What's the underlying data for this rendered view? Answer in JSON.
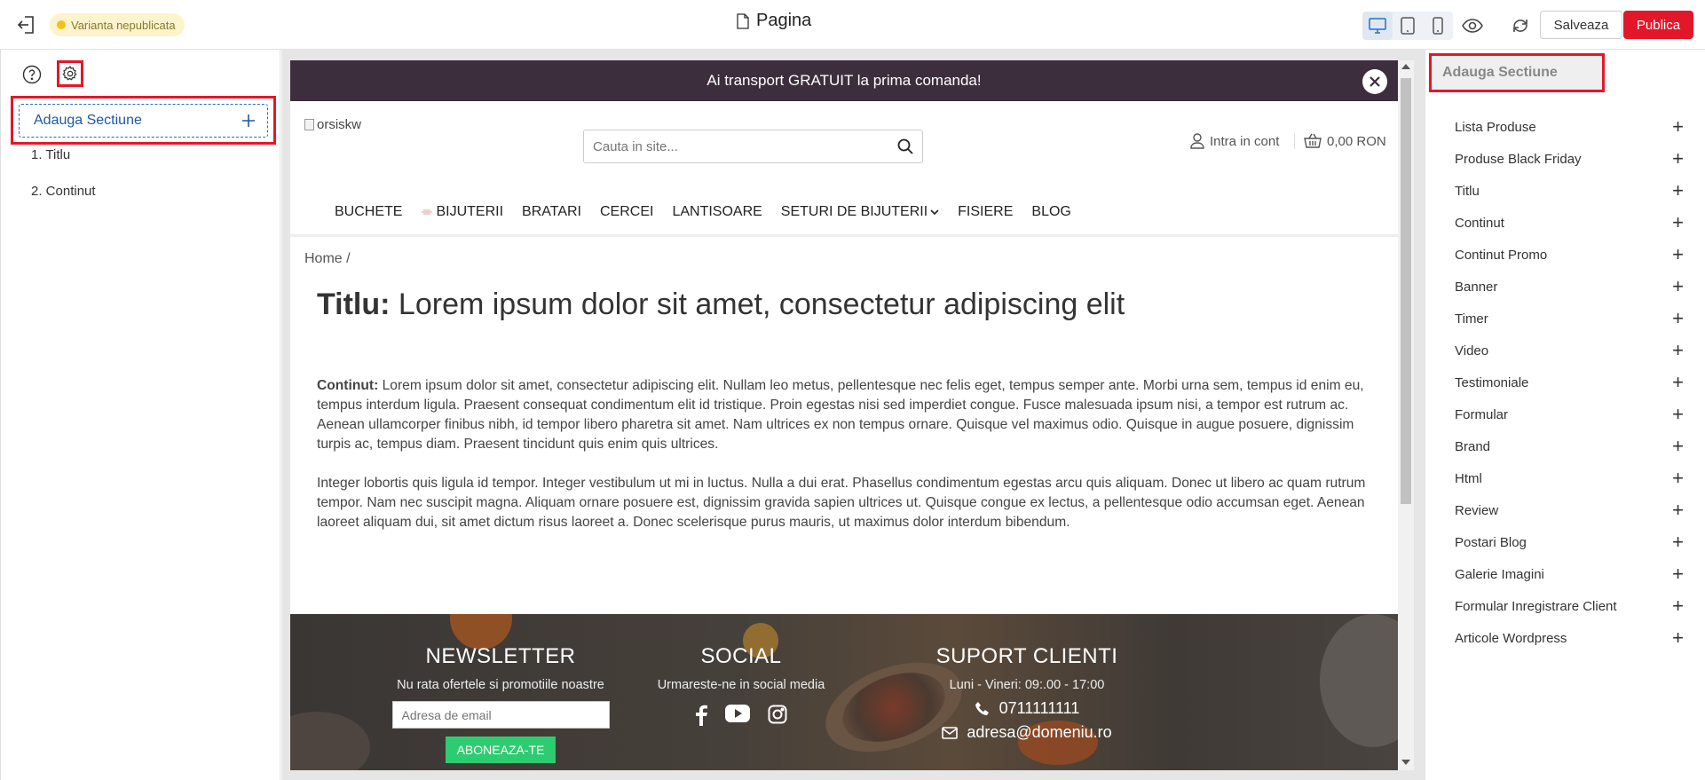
{
  "topbar": {
    "status_badge": "Varianta nepublicata",
    "page_title": "Pagina",
    "save_label": "Salveaza",
    "publish_label": "Publica"
  },
  "left_panel": {
    "add_section_label": "Adauga Sectiune",
    "sections": [
      "1. Titlu",
      "2. Continut"
    ]
  },
  "preview": {
    "promo_text": "Ai transport GRATUIT la prima comanda!",
    "logo_alt": "orsiskw",
    "search_placeholder": "Cauta in site...",
    "account_label": "Intra in cont",
    "cart_total": "0,00 RON",
    "nav": [
      "BUCHETE",
      "BIJUTERII",
      "BRATARI",
      "CERCEI",
      "LANTISOARE",
      "SETURI DE BIJUTERII",
      "FISIERE",
      "BLOG"
    ],
    "breadcrumb": "Home /",
    "title_label": "Titlu:",
    "title_text": "Lorem ipsum dolor sit amet, consectetur adipiscing elit",
    "content_label": "Continut:",
    "content_p1": "Lorem ipsum dolor sit amet, consectetur adipiscing elit. Nullam leo metus, pellentesque nec felis eget, tempus semper ante. Morbi urna sem, tempus id enim eu, tempus interdum ligula. Praesent consequat condimentum elit id tristique. Proin egestas nisi sed imperdiet congue. Fusce malesuada ipsum nisi, a tempor est rutrum ac. Aenean ullamcorper finibus nibh, id tempor libero pharetra sit amet. Nam ultrices ex non tempus ornare. Quisque vel maximus odio. Quisque in augue posuere, dignissim turpis ac, tempus diam. Praesent tincidunt quis enim quis ultrices.",
    "content_p2": "Integer lobortis quis ligula id tempor. Integer vestibulum ut mi in luctus. Nulla a dui erat. Phasellus condimentum egestas arcu quis aliquam. Donec ut libero ac quam rutrum tempor. Nam nec suscipit magna. Aliquam ornare posuere est, dignissim gravida sapien ultrices ut. Quisque congue ex lectus, a pellentesque odio accumsan eget. Aenean laoreet aliquam dui, sit amet dictum risus laoreet a. Donec scelerisque purus mauris, ut maximus dolor interdum bibendum.",
    "footer": {
      "newsletter_title": "NEWSLETTER",
      "newsletter_sub": "Nu rata ofertele si promotiile noastre",
      "email_placeholder": "Adresa de email",
      "subscribe_label": "ABONEAZA-TE",
      "social_title": "SOCIAL",
      "social_sub": "Urmareste-ne in social media",
      "support_title": "SUPORT CLIENTI",
      "support_hours": "Luni - Vineri: 09:.00 - 17:00",
      "phone": "0711111111",
      "email": "adresa@domeniu.ro"
    }
  },
  "right_panel": {
    "header": "Adauga Sectiune",
    "items": [
      "Lista Produse",
      "Produse Black Friday",
      "Titlu",
      "Continut",
      "Continut Promo",
      "Banner",
      "Timer",
      "Video",
      "Testimoniale",
      "Formular",
      "Brand",
      "Html",
      "Review",
      "Postari Blog",
      "Galerie Imagini",
      "Formular Inregistrare Client",
      "Articole Wordpress"
    ]
  },
  "colors": {
    "accent_red": "#e3172a",
    "link_blue": "#1c58a8",
    "promo_bg": "#3d2e3e",
    "subscribe_green": "#2ecc71"
  },
  "icons": {
    "exit": "exit-icon",
    "document": "document-icon",
    "desktop": "desktop-icon",
    "tablet": "tablet-icon",
    "mobile": "mobile-icon",
    "preview": "eye-icon",
    "sync": "sync-icon",
    "help": "help-icon",
    "settings": "gear-icon"
  }
}
